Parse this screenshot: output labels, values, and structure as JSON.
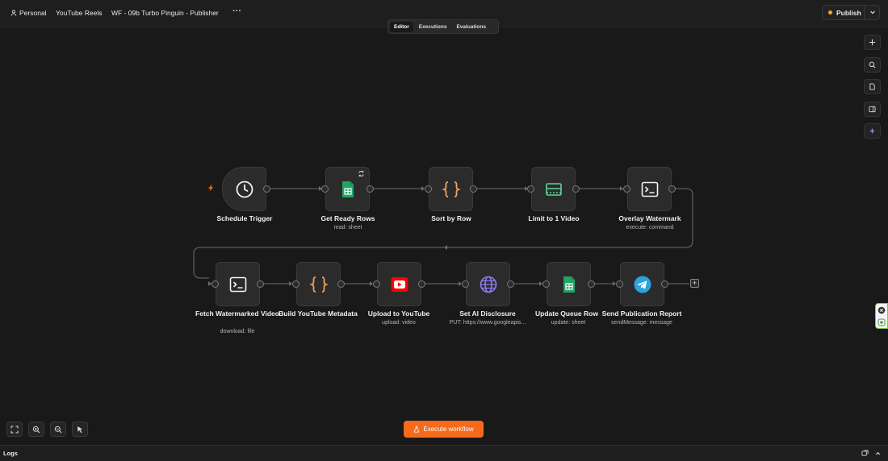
{
  "header": {
    "personal": "Personal",
    "project": "YouTube Reels",
    "workflow_name": "WF - 09b Turbo Pinguin - Publisher",
    "more": "···",
    "publish_label": "Publish"
  },
  "tabs": [
    {
      "label": "Editor",
      "active": true
    },
    {
      "label": "Executions",
      "active": false
    },
    {
      "label": "Evaluations",
      "active": false
    }
  ],
  "nodes": [
    {
      "title": "Schedule Trigger",
      "subtitle": "",
      "icon": "clock-icon"
    },
    {
      "title": "Get Ready Rows",
      "subtitle": "read: sheet",
      "icon": "google-sheets-icon"
    },
    {
      "title": "Sort by Row",
      "subtitle": "",
      "icon": "code-braces-icon"
    },
    {
      "title": "Limit to 1 Video",
      "subtitle": "",
      "icon": "limit-icon"
    },
    {
      "title": "Overlay Watermark",
      "subtitle": "execute: command",
      "icon": "terminal-icon"
    },
    {
      "title": "Fetch Watermarked Video",
      "subtitle": "download: file",
      "icon": "terminal-icon"
    },
    {
      "title": "Build YouTube Metadata",
      "subtitle": "",
      "icon": "code-braces-icon"
    },
    {
      "title": "Upload to YouTube",
      "subtitle": "upload: video",
      "icon": "youtube-icon"
    },
    {
      "title": "Set AI Disclosure",
      "subtitle": "PUT: https://www.googleapis...",
      "icon": "globe-icon"
    },
    {
      "title": "Update Queue Row",
      "subtitle": "update: sheet",
      "icon": "google-sheets-icon"
    },
    {
      "title": "Send Publication Report",
      "subtitle": "sendMessage: message",
      "icon": "telegram-icon"
    }
  ],
  "footer": {
    "execute_label": "Execute workflow",
    "logs_label": "Logs"
  },
  "colors": {
    "accent": "#f56a1b",
    "sheets_green": "#21a464",
    "braces_orange": "#f0a35a",
    "limit_green": "#5fd39a",
    "youtube_red": "#ff0000",
    "globe_purple": "#8c7cf0",
    "telegram_blue": "#2aa3e0",
    "publish_dot": "#f5a623"
  }
}
